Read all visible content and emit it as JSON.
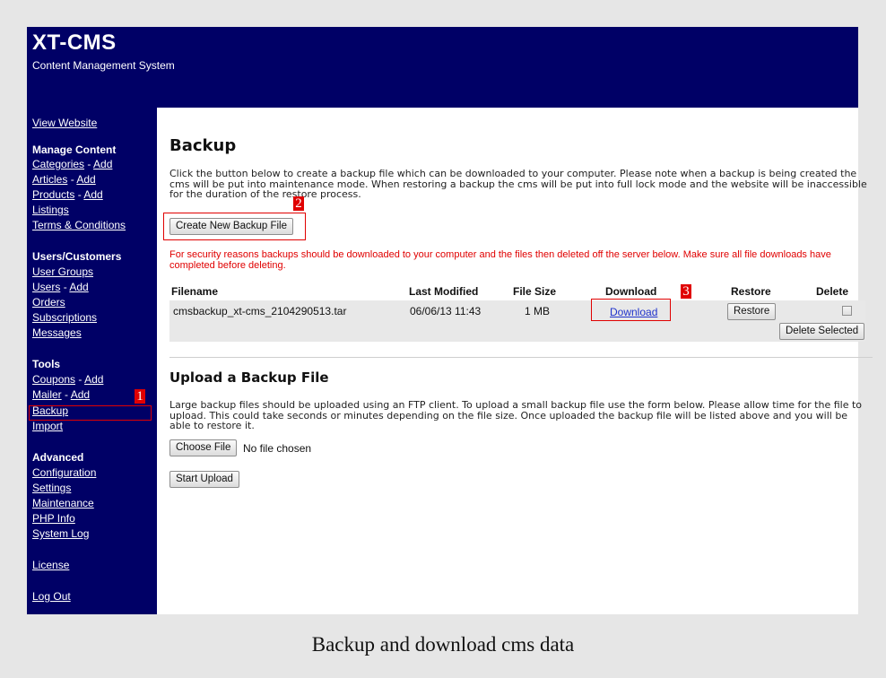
{
  "header": {
    "title": "XT-CMS",
    "subtitle": "Content Management System"
  },
  "sidebar": {
    "view_website": "View Website",
    "manage_content": {
      "heading": "Manage Content",
      "categories": "Categories",
      "articles": "Articles",
      "products": "Products",
      "add": "Add",
      "sep": "-",
      "listings": "Listings",
      "terms": "Terms & Conditions"
    },
    "users_customers": {
      "heading": "Users/Customers",
      "user_groups": "User Groups",
      "users": "Users",
      "orders": "Orders",
      "subscriptions": "Subscriptions",
      "messages": "Messages"
    },
    "tools": {
      "heading": "Tools",
      "coupons": "Coupons",
      "mailer": "Mailer",
      "backup": "Backup",
      "import": "Import"
    },
    "advanced": {
      "heading": "Advanced",
      "configuration": "Configuration",
      "settings": "Settings",
      "maintenance": "Maintenance",
      "php_info": "PHP Info",
      "system_log": "System Log"
    },
    "license": "License",
    "log_out": "Log Out"
  },
  "main": {
    "title": "Backup",
    "intro": "Click the button below to create a backup file which can be downloaded to your computer. Please note when a backup is being created the cms will be put into maintenance mode. When restoring a backup the cms will be put into full lock mode and the website will be inaccessible for the duration of the restore process.",
    "create_button": "Create New Backup File",
    "warning": "For security reasons backups should be downloaded to your computer and the files then deleted off the server below. Make sure all file downloads have completed before deleting.",
    "table": {
      "headers": [
        "Filename",
        "Last Modified",
        "File Size",
        "Download",
        "Restore",
        "Delete"
      ],
      "rows": [
        {
          "filename": "cmsbackup_xt-cms_2104290513.tar",
          "last_modified": "06/06/13 11:43",
          "file_size": "1 MB",
          "download": "Download",
          "restore": "Restore",
          "delete_checked": false
        }
      ],
      "delete_selected": "Delete Selected"
    },
    "upload": {
      "title": "Upload a Backup File",
      "text": "Large backup files should be uploaded using an FTP client. To upload a small backup file use the form below. Please allow time for the file to upload. This could take seconds or minutes depending on the file size. Once uploaded the backup file will be listed above and you will be able to restore it.",
      "choose_file": "Choose File",
      "no_file": "No file chosen",
      "start_upload": "Start Upload"
    }
  },
  "annotations": {
    "step1": "1",
    "step2": "2",
    "step3": "3",
    "marker_color": "#e00000"
  },
  "caption": "Backup and download cms data"
}
